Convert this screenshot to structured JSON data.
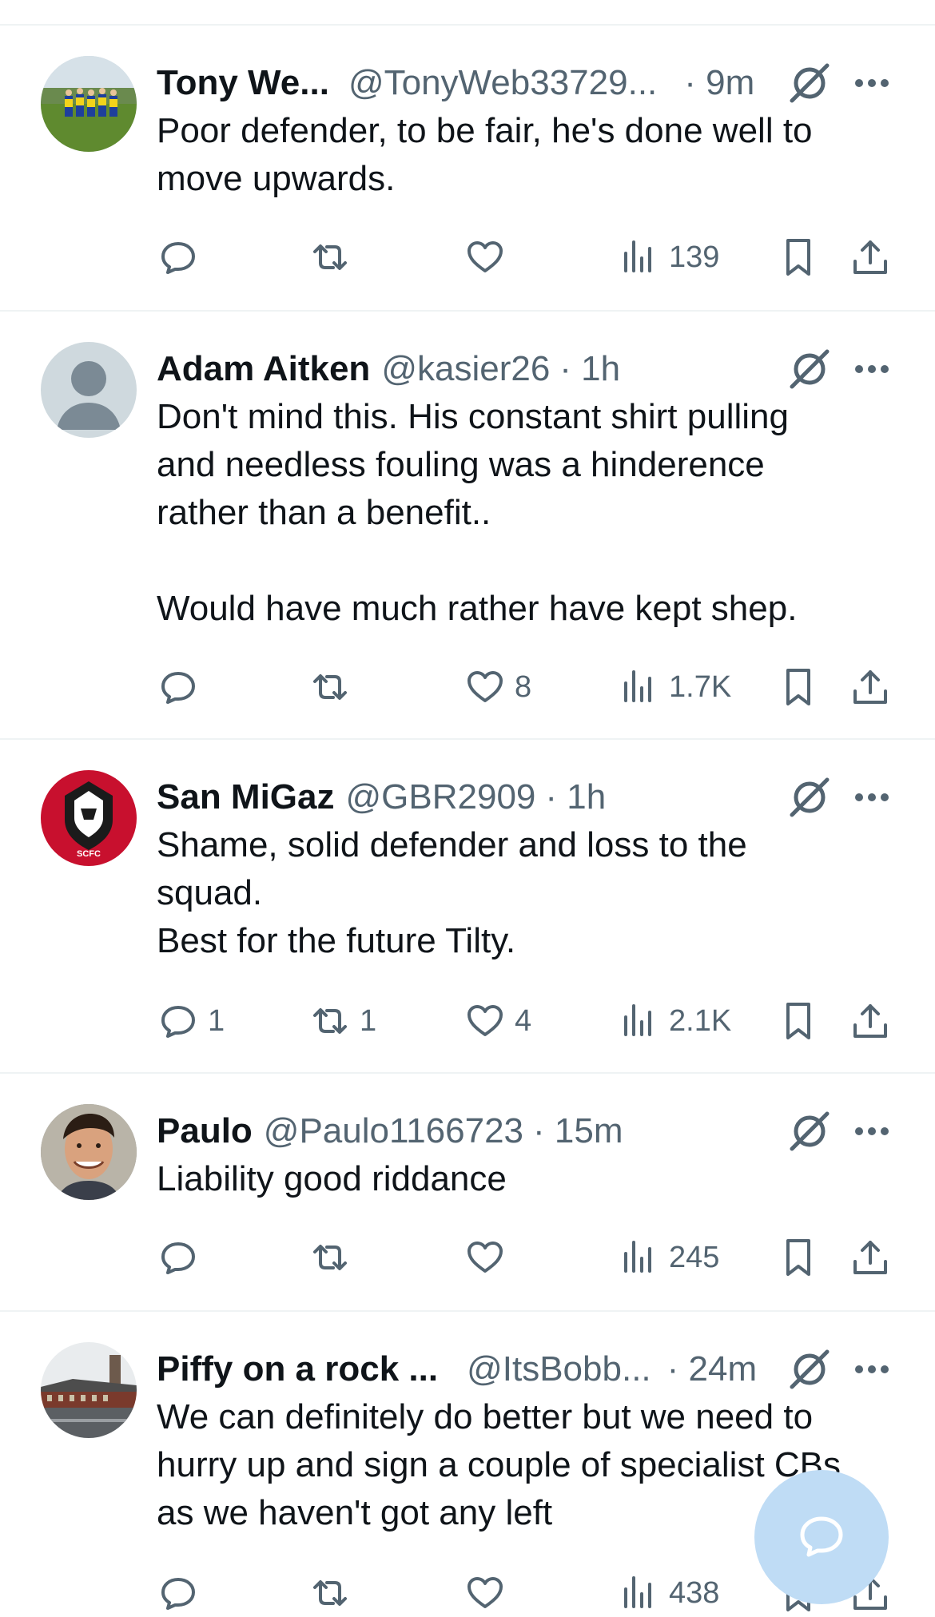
{
  "tweets": [
    {
      "name": "Tony We...",
      "handle": "@TonyWeb33729...",
      "time": "· 9m",
      "avatar": "team-photo",
      "text": "Poor defender, to be fair, he's done well to\nmove upwards.",
      "replies": "",
      "reposts": "",
      "likes": "",
      "views": "139"
    },
    {
      "name": "Adam Aitken",
      "handle": "@kasier26",
      "time": "· 1h",
      "avatar": "default-user",
      "text": "Don't mind this. His constant shirt pulling\nand needless fouling was a hinderence\nrather than a benefit..\n\nWould have much rather have kept shep.",
      "replies": "",
      "reposts": "",
      "likes": "8",
      "views": "1.7K"
    },
    {
      "name": "San MiGaz",
      "handle": "@GBR2909",
      "time": "· 1h",
      "avatar": "scfc-lion-badge",
      "avatar_text": "SCFC",
      "text": "Shame, solid defender and loss to the\nsquad.\nBest for the future Tilty.",
      "replies": "1",
      "reposts": "1",
      "likes": "4",
      "views": "2.1K"
    },
    {
      "name": "Paulo",
      "handle": "@Paulo1166723",
      "time": "· 15m",
      "avatar": "smiling-man",
      "text": "Liability good riddance",
      "replies": "",
      "reposts": "",
      "likes": "",
      "views": "245"
    },
    {
      "name": "Piffy on a rock ...",
      "handle": "@ItsBobb...",
      "time": "· 24m",
      "avatar": "stadium-photo",
      "text": "We can definitely do better but we need to\nhurry up and sign a couple of specialist CBs\nas we haven't got any left",
      "replies": "",
      "reposts": "",
      "likes": "",
      "views": "438"
    }
  ],
  "icons": {
    "reply": "reply-icon",
    "repost": "repost-icon",
    "like": "heart-icon",
    "views": "views-icon",
    "bookmark": "bookmark-icon",
    "share": "share-icon",
    "grok": "grok-icon",
    "more": "more-icon",
    "compose": "compose-reply-icon"
  },
  "colors": {
    "text": "#0f1419",
    "secondary": "#536471",
    "divider": "#eff3f4",
    "fab": "#bfdcf5"
  }
}
